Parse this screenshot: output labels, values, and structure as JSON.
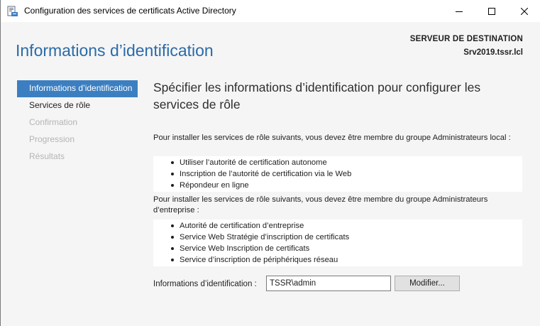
{
  "window": {
    "title": "Configuration des services de certificats Active Directory",
    "icon": "certificate-services-icon"
  },
  "header": {
    "page_title": "Informations d’identification",
    "destination_label": "SERVEUR DE DESTINATION",
    "destination_server": "Srv2019.tssr.lcl"
  },
  "nav": {
    "items": [
      {
        "label": "Informations d’identification",
        "state": "active"
      },
      {
        "label": "Services de rôle",
        "state": "enabled"
      },
      {
        "label": "Confirmation",
        "state": "disabled"
      },
      {
        "label": "Progression",
        "state": "disabled"
      },
      {
        "label": "Résultats",
        "state": "disabled"
      }
    ]
  },
  "main": {
    "heading": "Spécifier les informations d’identification pour configurer les services de rôle",
    "local_admin_text": "Pour installer les services de rôle suivants, vous devez être membre du groupe Administrateurs local :",
    "local_admin_services": [
      "Utiliser l’autorité de certification autonome",
      "Inscription de l’autorité de certification via le Web",
      "Répondeur en ligne"
    ],
    "enterprise_admin_text": "Pour installer les services de rôle suivants, vous devez être membre du groupe Administrateurs d’entreprise :",
    "enterprise_admin_services": [
      "Autorité de certification d’entreprise",
      "Service Web Stratégie d’inscription de certificats",
      "Service Web Inscription de certificats",
      "Service d’inscription de périphériques réseau"
    ],
    "credentials_label": "Informations d’identification :",
    "credentials_value": "TSSR\\admin",
    "modify_button": "Modifier..."
  },
  "colors": {
    "accent": "#3c7fc1",
    "title_blue": "#2b6aa8",
    "disabled_text": "#b4b4b4"
  }
}
